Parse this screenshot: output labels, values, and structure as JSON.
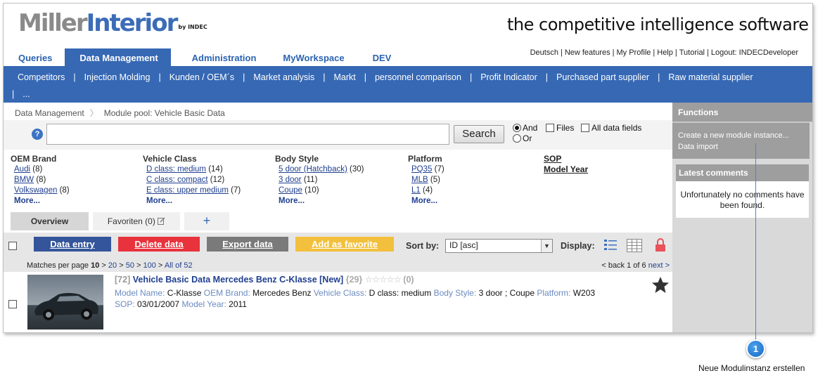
{
  "header": {
    "logo_miller": "Miller",
    "logo_interior": "Interior",
    "logo_by": "by INDEC",
    "tagline": "the competitive intelligence software"
  },
  "main_tabs": [
    "Queries",
    "Data Management",
    "Administration",
    "MyWorkspace",
    "DEV"
  ],
  "active_main_tab": "Data Management",
  "top_links": [
    "Deutsch",
    "New features",
    "My Profile",
    "Help",
    "Tutorial",
    "Logout: INDECDeveloper"
  ],
  "subnav": [
    "Competitors",
    "Injection Molding",
    "Kunden / OEM´s",
    "Market analysis",
    "Markt",
    "personnel comparison",
    "Profit Indicator",
    "Purchased part supplier",
    "Raw material supplier",
    "..."
  ],
  "breadcrumb": [
    "Data Management",
    "Module pool: Vehicle Basic Data"
  ],
  "search": {
    "help_icon": "?",
    "value": "",
    "button": "Search",
    "and_label": "And",
    "or_label": "Or",
    "files_label": "Files",
    "all_fields_label": "All data fields",
    "selected": "And"
  },
  "facets": [
    {
      "header": "OEM Brand",
      "items": [
        {
          "label": "Audi",
          "count": "(8)"
        },
        {
          "label": "BMW",
          "count": "(8)"
        },
        {
          "label": "Volkswagen",
          "count": "(8)"
        }
      ],
      "more": "More..."
    },
    {
      "header": "Vehicle Class",
      "items": [
        {
          "label": "D class: medium",
          "count": "(14)"
        },
        {
          "label": "C class: compact",
          "count": "(12)"
        },
        {
          "label": "E class: upper medium",
          "count": "(7)"
        }
      ],
      "more": "More..."
    },
    {
      "header": "Body Style",
      "items": [
        {
          "label": "5 door (Hatchback)",
          "count": "(30)"
        },
        {
          "label": "3 door",
          "count": "(11)"
        },
        {
          "label": "Coupe",
          "count": "(10)"
        }
      ],
      "more": "More..."
    },
    {
      "header": "Platform",
      "items": [
        {
          "label": "PQ35",
          "count": "(7)"
        },
        {
          "label": "MLB",
          "count": "(5)"
        },
        {
          "label": "L1",
          "count": "(4)"
        }
      ],
      "more": "More..."
    }
  ],
  "facet_extra": [
    "SOP",
    "Model Year"
  ],
  "content_tabs": {
    "overview": "Overview",
    "favorites": "Favoriten (0)",
    "add": "+"
  },
  "toolbar": {
    "data_entry": "Data entry",
    "delete_data": "Delete data",
    "export_data": "Export data",
    "add_favorite": "Add as favorite",
    "sort_label": "Sort by:",
    "sort_value": "ID [asc]",
    "display_label": "Display:",
    "colors": {
      "data_entry": "#34559a",
      "delete_data": "#e8323c",
      "export_data": "#7a7a7a",
      "add_favorite": "#f2c03c"
    }
  },
  "paging": {
    "matches_label": "Matches per page",
    "current": "10",
    "options": [
      "20",
      "50",
      "100",
      "All of 52"
    ],
    "back": "< back",
    "position": "1 of 6",
    "next": "next >"
  },
  "result": {
    "id": "[72]",
    "title": "Vehicle Basic Data Mercedes Benz C-Klasse [New]",
    "count": "{29}",
    "rating_count": "(0)",
    "rating_stars": 0,
    "fields_line1": [
      {
        "key": "Model Name:",
        "value": "C-Klasse"
      },
      {
        "key": "OEM Brand:",
        "value": "Mercedes Benz"
      },
      {
        "key": "Vehicle Class:",
        "value": "D class: medium"
      },
      {
        "key": "Body Style:",
        "value": "3 door ;  Coupe"
      },
      {
        "key": "Platform:",
        "value": "W203"
      }
    ],
    "fields_line2": [
      {
        "key": "SOP:",
        "value": "03/01/2007"
      },
      {
        "key": "Model Year:",
        "value": "2011"
      }
    ]
  },
  "sidebar": {
    "functions_title": "Functions",
    "functions": [
      "Create a new module instance...",
      "Data import"
    ],
    "comments_title": "Latest comments",
    "comments_empty": "Unfortunately no comments have been found."
  },
  "callout": {
    "number": "1",
    "text": "Neue Modulinstanz erstellen",
    "color": "#1f74d0"
  }
}
